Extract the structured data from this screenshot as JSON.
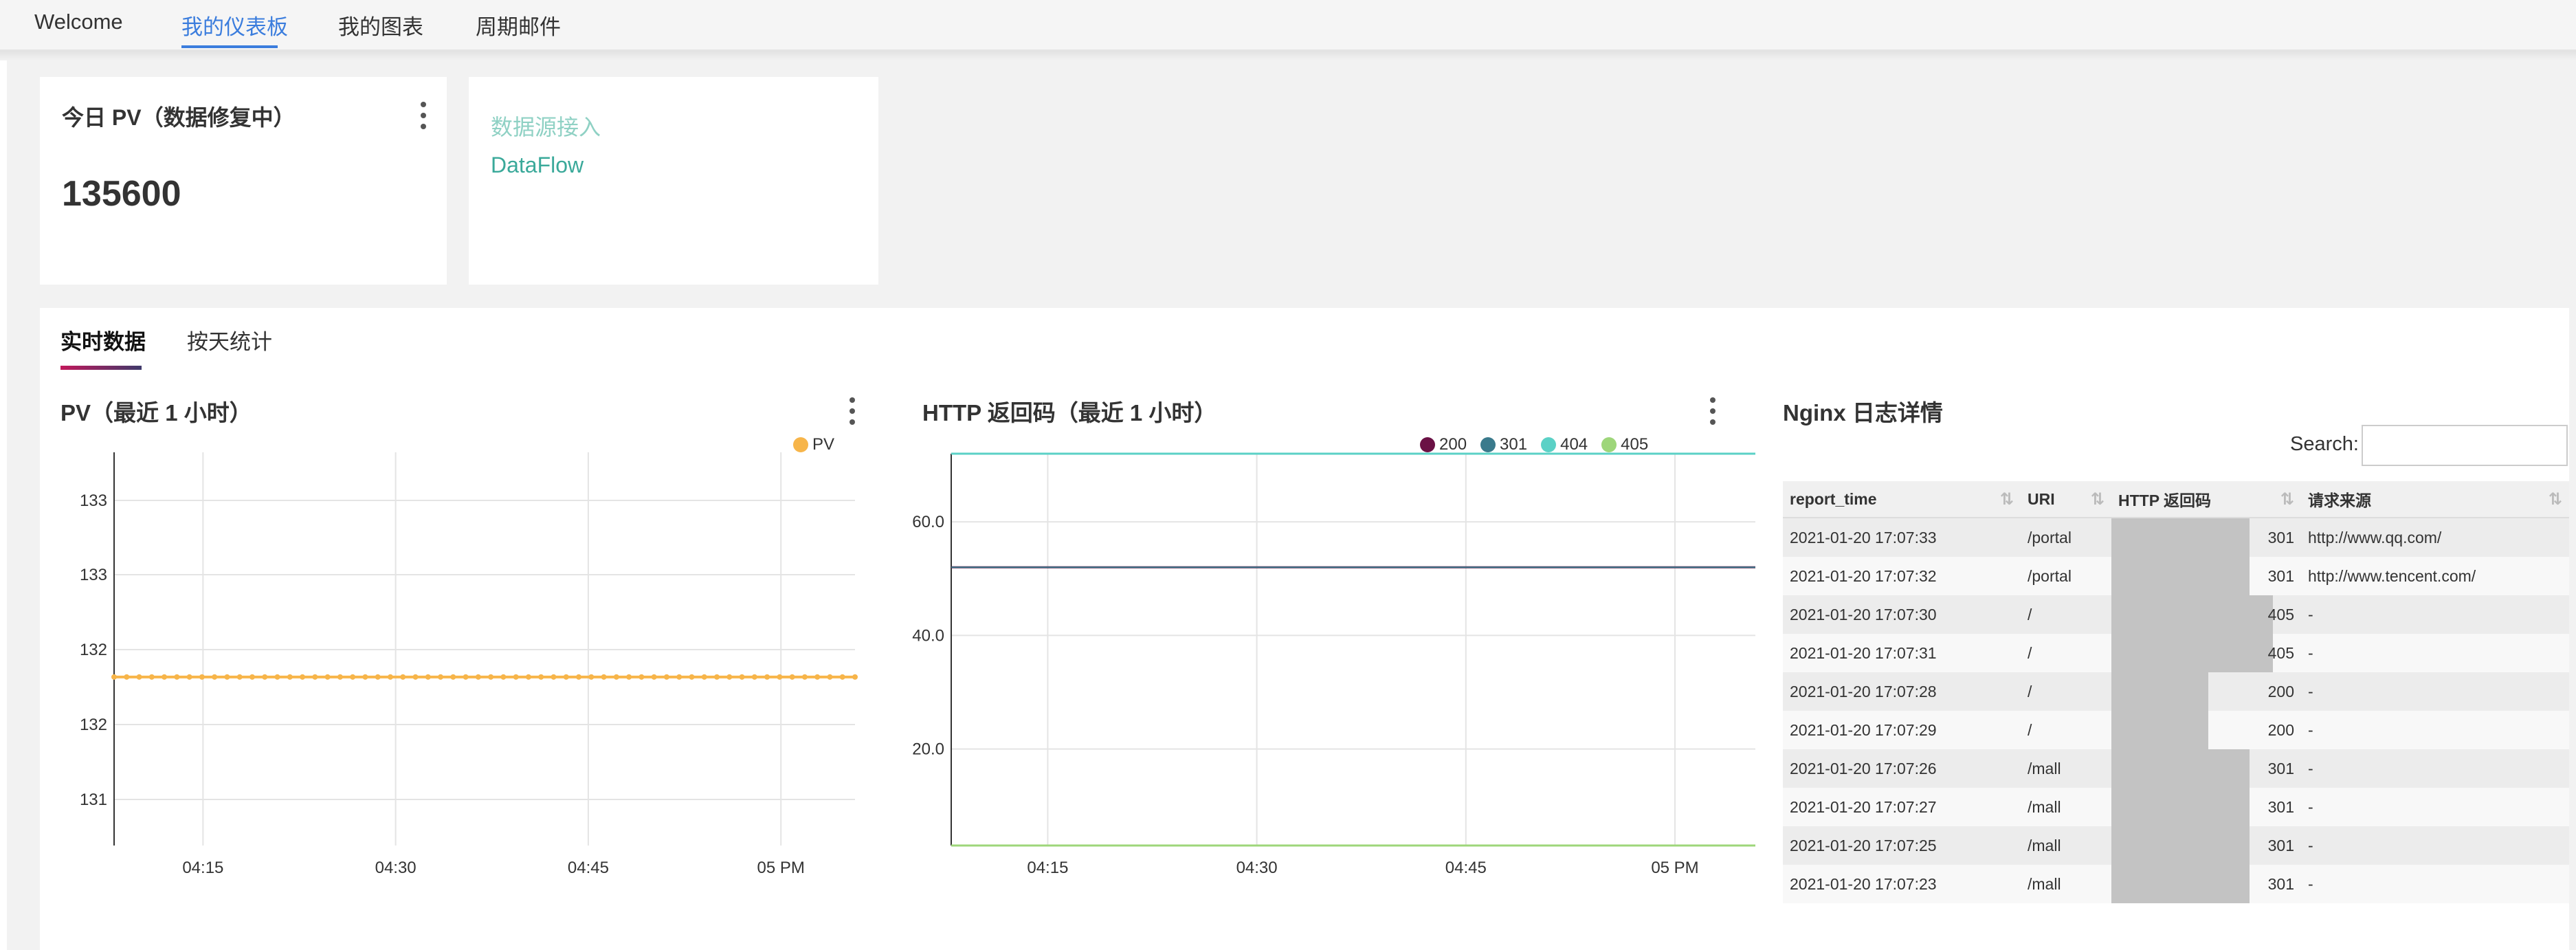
{
  "nav": {
    "tabs": [
      {
        "label": "Welcome"
      },
      {
        "label": "我的仪表板",
        "active": true
      },
      {
        "label": "我的图表"
      },
      {
        "label": "周期邮件"
      }
    ]
  },
  "kpi": {
    "title": "今日 PV（数据修复中）",
    "value": "135600"
  },
  "links": {
    "items": [
      "数据源接入",
      "DataFlow"
    ]
  },
  "subtabs": [
    {
      "label": "实时数据",
      "active": true
    },
    {
      "label": "按天统计"
    }
  ],
  "pv_chart": {
    "title": "PV（最近 1 小时）",
    "legend": "PV"
  },
  "http_chart": {
    "title": "HTTP 返回码（最近 1 小时）",
    "legend": [
      "200",
      "301",
      "404",
      "405"
    ]
  },
  "nginx": {
    "title": "Nginx 日志详情",
    "search_label": "Search:",
    "columns": [
      "report_time",
      "URI",
      "HTTP 返回码",
      "请求来源"
    ],
    "sort_icon": "⇅",
    "rows": [
      {
        "time": "2021-01-20 17:07:33",
        "uri": "/portal",
        "code": "301",
        "ref": "http://www.qq.com/"
      },
      {
        "time": "2021-01-20 17:07:32",
        "uri": "/portal",
        "code": "301",
        "ref": "http://www.tencent.com/"
      },
      {
        "time": "2021-01-20 17:07:30",
        "uri": "/",
        "code": "405",
        "ref": "-"
      },
      {
        "time": "2021-01-20 17:07:31",
        "uri": "/",
        "code": "405",
        "ref": "-"
      },
      {
        "time": "2021-01-20 17:07:28",
        "uri": "/",
        "code": "200",
        "ref": "-"
      },
      {
        "time": "2021-01-20 17:07:29",
        "uri": "/",
        "code": "200",
        "ref": "-"
      },
      {
        "time": "2021-01-20 17:07:26",
        "uri": "/mall",
        "code": "301",
        "ref": "-"
      },
      {
        "time": "2021-01-20 17:07:27",
        "uri": "/mall",
        "code": "301",
        "ref": "-"
      },
      {
        "time": "2021-01-20 17:07:25",
        "uri": "/mall",
        "code": "301",
        "ref": "-"
      },
      {
        "time": "2021-01-20 17:07:23",
        "uri": "/mall",
        "code": "301",
        "ref": "-"
      }
    ]
  },
  "chart_data": [
    {
      "type": "line",
      "title": "PV（最近 1 小时）",
      "x_ticks": [
        "04:15",
        "04:30",
        "04:45",
        "05 PM"
      ],
      "y_ticks": [
        "133",
        "133",
        "132",
        "132",
        "131"
      ],
      "ylim": [
        130.8,
        133.6
      ],
      "series": [
        {
          "name": "PV",
          "color": "#f7b54a",
          "value": 132.0,
          "points": 60
        }
      ],
      "legend_position": "top-right",
      "grid": true
    },
    {
      "type": "line",
      "title": "HTTP 返回码（最近 1 小时）",
      "x_ticks": [
        "04:15",
        "04:30",
        "04:45",
        "05 PM"
      ],
      "y_ticks": [
        "60.0",
        "40.0",
        "20.0"
      ],
      "ylim": [
        3,
        72
      ],
      "series": [
        {
          "name": "200",
          "color": "#6b1145",
          "value": 52
        },
        {
          "name": "301",
          "color": "#3a7a8c",
          "value": 52
        },
        {
          "name": "404",
          "color": "#5bd1c6",
          "value": 72
        },
        {
          "name": "405",
          "color": "#9ed67a",
          "value": 3
        }
      ],
      "legend_position": "top-right",
      "grid": true
    }
  ]
}
